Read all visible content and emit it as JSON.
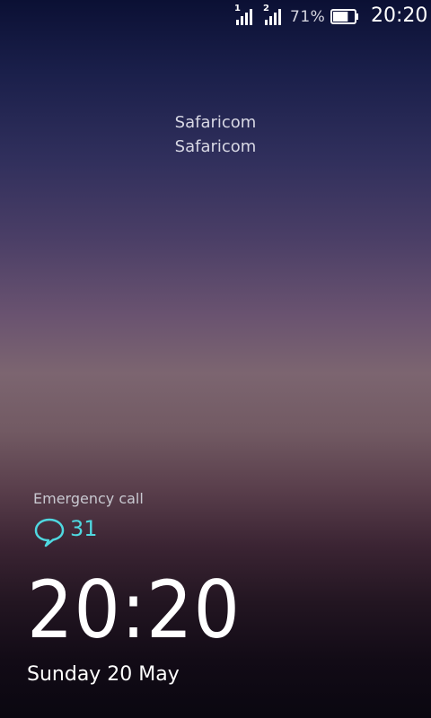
{
  "status_bar": {
    "sim1_label": "1",
    "sim2_label": "2",
    "battery_percent": "71%",
    "battery_level": 0.71,
    "time": "20:20",
    "icons": [
      "signal-sim1-icon",
      "signal-sim2-icon",
      "battery-icon"
    ]
  },
  "carrier": {
    "line1": "Safaricom",
    "line2": "Safaricom"
  },
  "lockscreen": {
    "emergency_label": "Emergency call",
    "message_icon": "chat-bubble-icon",
    "message_count": "31",
    "clock": "20:20",
    "date": "Sunday 20 May"
  },
  "colors": {
    "accent": "#4fd8e0",
    "text": "#ffffff"
  }
}
